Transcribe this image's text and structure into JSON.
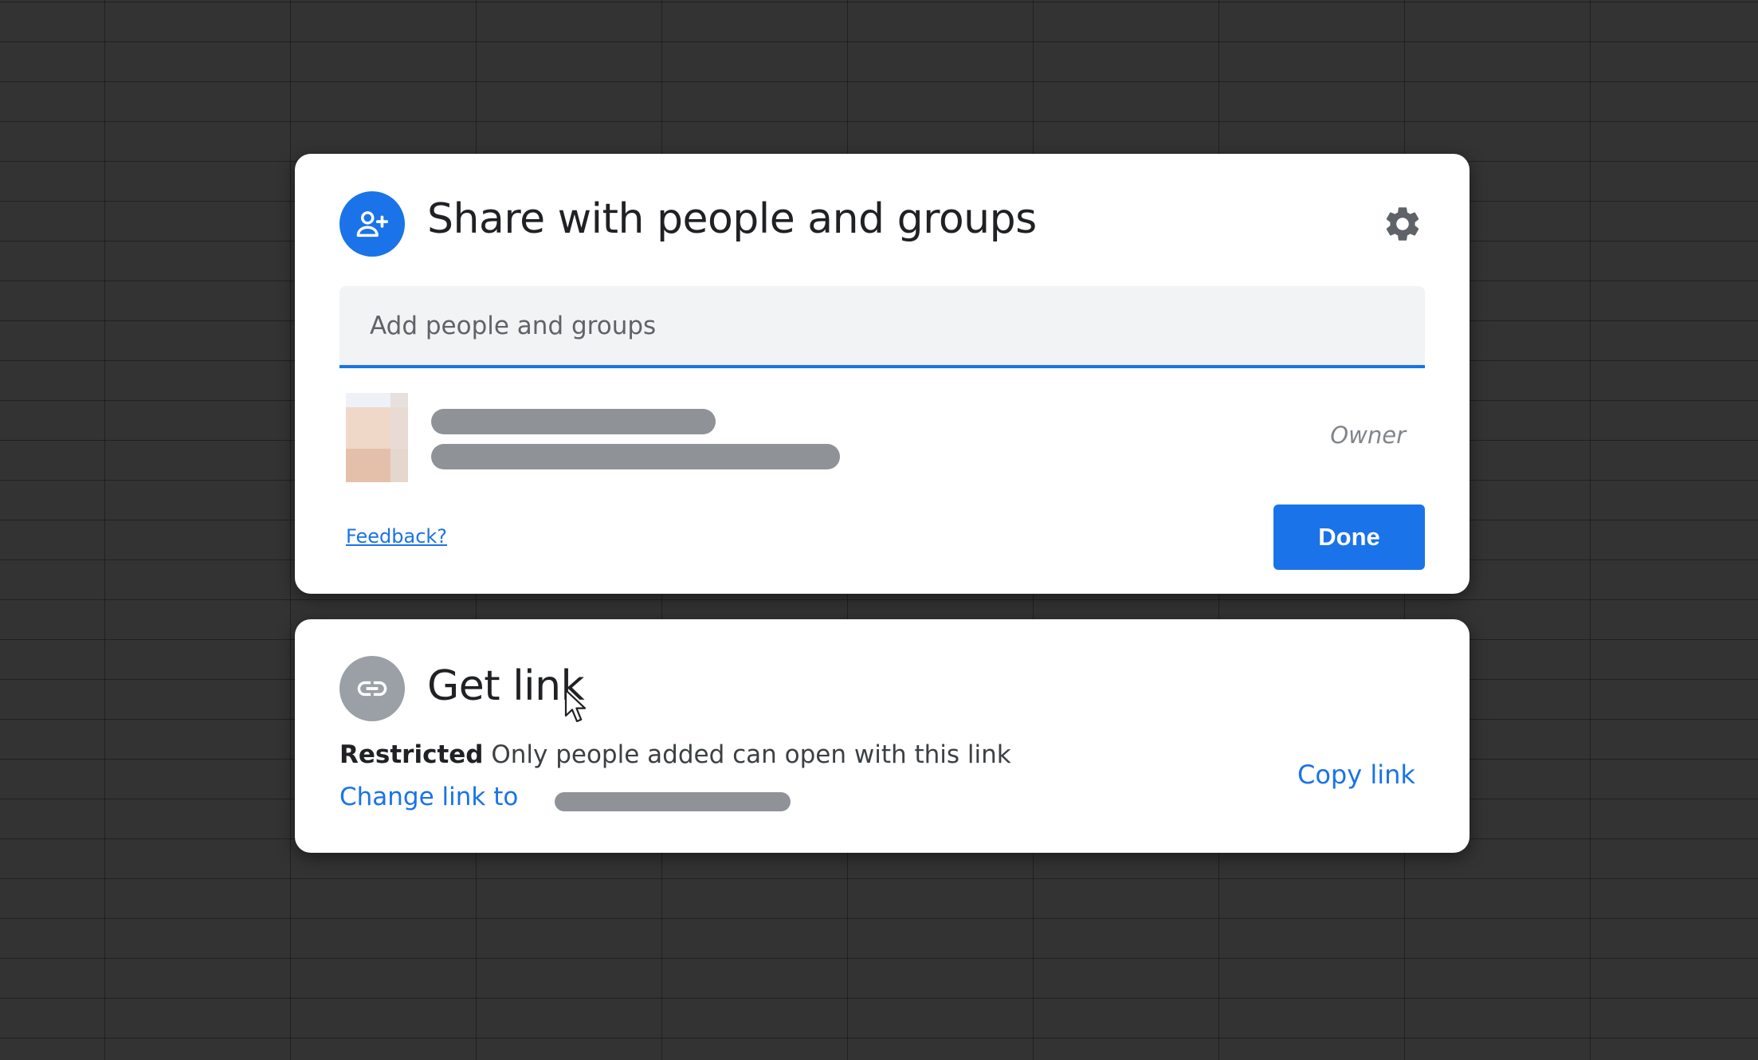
{
  "share_dialog": {
    "title": "Share with people and groups",
    "add_input_placeholder": "Add people and groups",
    "people": [
      {
        "name": "",
        "email": "",
        "role": "Owner"
      }
    ],
    "feedback_label": "Feedback?",
    "done_label": "Done",
    "icons": {
      "header": "person-add-icon",
      "settings": "gear-icon"
    }
  },
  "link_dialog": {
    "title": "Get link",
    "access_level": "Restricted",
    "access_description": "Only people added can open with this link",
    "change_link_prefix": "Change link to",
    "copy_link_label": "Copy link",
    "icons": {
      "header": "link-icon"
    }
  },
  "colors": {
    "accent": "#1a73e8",
    "background": "#333333",
    "card": "#ffffff",
    "muted_icon": "#9aa0a6",
    "redaction": "#8f9297"
  }
}
